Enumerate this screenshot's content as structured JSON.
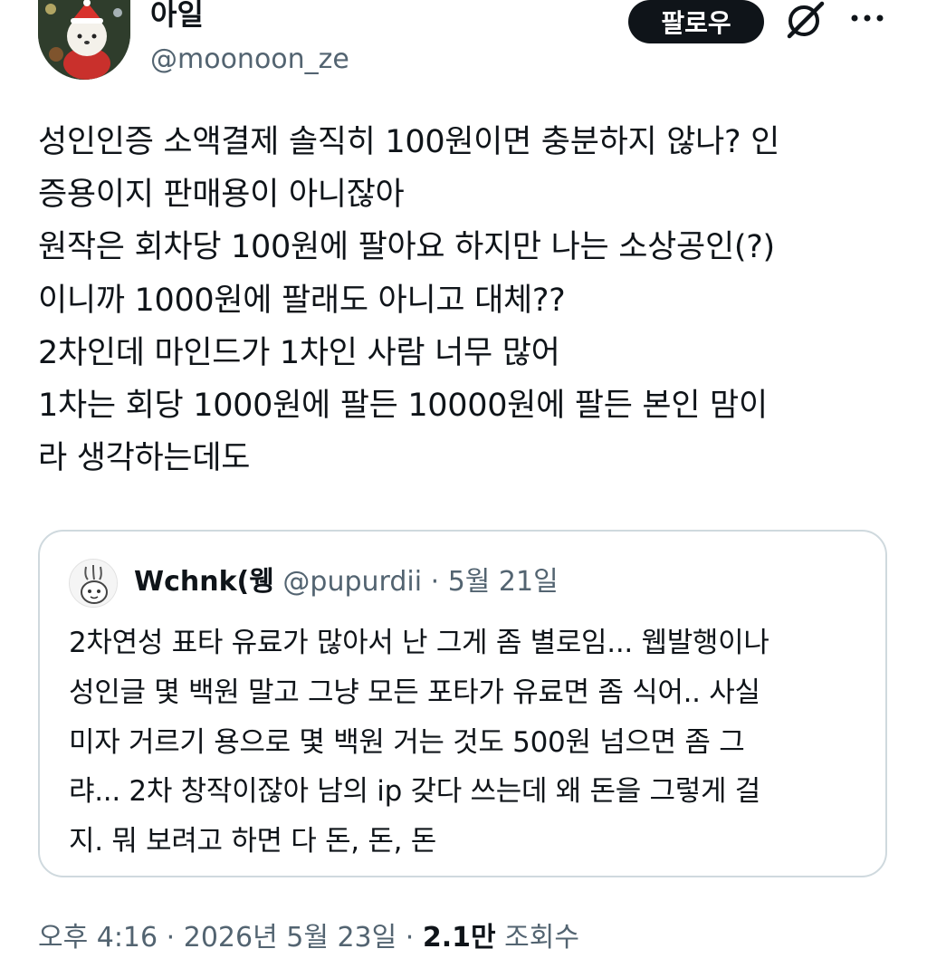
{
  "author": {
    "name": "아일",
    "handle": "@moonoon_ze"
  },
  "actions": {
    "follow_label": "팔로우",
    "grok_icon": "grok-icon",
    "more_icon": "more-icon"
  },
  "tweet": {
    "lines": [
      "성인인증 소액결제 솔직히 100원이면 충분하지 않나? 인",
      "증용이지 판매용이 아니잖아",
      "원작은 회차당 100원에 팔아요 하지만 나는 소상공인(?)",
      "이니까 1000원에 팔래도 아니고 대체??",
      "2차인데 마인드가 1차인 사람 너무 많어",
      "1차는 회당 1000원에 팔든 10000원에 팔든 본인 맘이",
      "라 생각하는데도"
    ]
  },
  "quote": {
    "name": "Wchnk(웽",
    "handle": "@pupurdii",
    "separator": "·",
    "date": "5월 21일",
    "lines": [
      "2차연성 표타 유료가 많아서 난 그게 좀 별로임... 웹발행이나",
      "성인글 몇 백원 말고 그냥 모든 포타가 유료면 좀 식어.. 사실",
      "미자 거르기 용으로 몇 백원 거는 것도 500원 넘으면 좀 그",
      "랴... 2차 창작이잖아 남의 ip 갖다 쓰는데 왜 돈을 그렇게 걸",
      "지. 뭐 보려고 하면 다 돈, 돈, 돈"
    ]
  },
  "footer": {
    "time": "오후 4:16",
    "separator": "·",
    "date": "2026년 5월 23일",
    "views_count": "2.1만",
    "views_label": "조회수"
  },
  "colors": {
    "text": "#0f1419",
    "secondary": "#536471",
    "border": "#cfd9de",
    "button_bg": "#0f1419"
  }
}
